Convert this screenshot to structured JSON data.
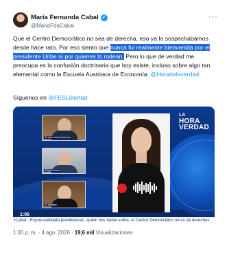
{
  "author": {
    "name": "María Fernanda Cabal",
    "handle": "@MariaFdaCabal",
    "verified_mark": "✓",
    "more_label": "···"
  },
  "tweet": {
    "text_before": "Que el Centro Democrático no sea de derecha, eso ya lo sospechábamos desde hace rato. Por eso siento que ",
    "text_highlight": "nunca fui realmente bienvenida por el presidente Uribe ni por quienes lo rodean.",
    "text_after": " Pero lo que de verdad me preocupa es la confusión doctrinaria que hoy existe, incluso sobre algo tan elemental como la Escuela Austriaca de Economía. ",
    "mention": "@Horadelaverdad",
    "follow_prefix": "Síguenos en ",
    "follow_handle": "@FESLibertad"
  },
  "video": {
    "logo_small": "LA",
    "logo_big": "HORA",
    "logo_big2": "VERDAD",
    "elapsed": "1:06",
    "ticker": "iCabal - Exprecandidata presidencial , quien nos habla sobre, el Centro Democrático no es de derechas",
    "panel_tags": [
      "P. Luis Carlos Cabrerizo",
      "Diego Orozco",
      "P. Delaney"
    ]
  },
  "meta": {
    "time": "1:30 p. m.",
    "sep1": "·",
    "date": "4 ago. 2026",
    "sep2": "·",
    "views_count": "19,6 mil",
    "views_label": "Visualizaciones"
  },
  "colors": {
    "highlight": "#1f66d6",
    "link": "#1d9bf0",
    "video_bg": "#0d3a8c"
  }
}
